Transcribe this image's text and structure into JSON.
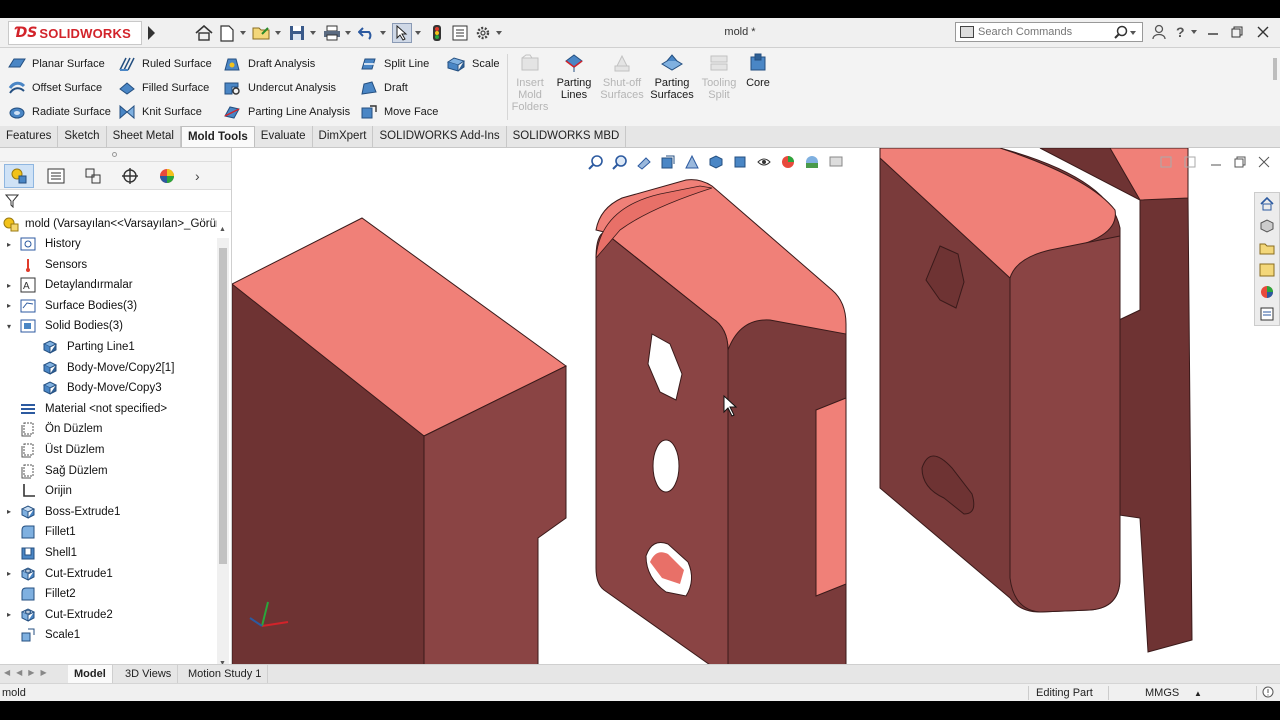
{
  "title_bar": {
    "app_name": "SOLIDWORKS",
    "document_title": "mold *",
    "search_placeholder": "Search Commands"
  },
  "ribbon": {
    "col1": [
      "Planar Surface",
      "Offset Surface",
      "Radiate Surface"
    ],
    "col2": [
      "Ruled Surface",
      "Filled Surface",
      "Knit Surface"
    ],
    "col3": [
      "Draft Analysis",
      "Undercut Analysis",
      "Parting Line Analysis"
    ],
    "col4": [
      "Split Line",
      "Draft",
      "Move Face"
    ],
    "scale": "Scale",
    "big_buttons": [
      {
        "label": "Insert Mold Folders",
        "enabled": false
      },
      {
        "label": "Parting Lines",
        "enabled": true
      },
      {
        "label": "Shut-off Surfaces",
        "enabled": false
      },
      {
        "label": "Parting Surfaces",
        "enabled": true
      },
      {
        "label": "Tooling Split",
        "enabled": false
      },
      {
        "label": "Core",
        "enabled": true
      }
    ]
  },
  "tabs": [
    "Features",
    "Sketch",
    "Sheet Metal",
    "Mold Tools",
    "Evaluate",
    "DimXpert",
    "SOLIDWORKS Add-Ins",
    "SOLIDWORKS MBD"
  ],
  "active_tab": "Mold Tools",
  "feature_tree": {
    "root": "mold  (Varsayılan<<Varsayılan>_Görün",
    "nodes": [
      {
        "label": "History",
        "icon": "history-icon",
        "expandable": true,
        "indent": 0
      },
      {
        "label": "Sensors",
        "icon": "sensors-icon",
        "expandable": false,
        "indent": 0
      },
      {
        "label": "Detaylandırmalar",
        "icon": "annotations-icon",
        "expandable": true,
        "indent": 0
      },
      {
        "label": "Surface Bodies(3)",
        "icon": "surface-bodies-icon",
        "expandable": true,
        "indent": 0
      },
      {
        "label": "Solid Bodies(3)",
        "icon": "solid-bodies-icon",
        "expandable": true,
        "expanded": true,
        "indent": 0
      },
      {
        "label": "Parting Line1",
        "icon": "body-icon",
        "expandable": false,
        "indent": 1
      },
      {
        "label": "Body-Move/Copy2[1]",
        "icon": "body-icon",
        "expandable": false,
        "indent": 1
      },
      {
        "label": "Body-Move/Copy3",
        "icon": "body-icon",
        "expandable": false,
        "indent": 1
      },
      {
        "label": "Material <not specified>",
        "icon": "material-icon",
        "expandable": false,
        "indent": 0
      },
      {
        "label": "Ön Düzlem",
        "icon": "plane-icon",
        "expandable": false,
        "indent": 0
      },
      {
        "label": "Üst Düzlem",
        "icon": "plane-icon",
        "expandable": false,
        "indent": 0
      },
      {
        "label": "Sağ Düzlem",
        "icon": "plane-icon",
        "expandable": false,
        "indent": 0
      },
      {
        "label": "Orijin",
        "icon": "origin-icon",
        "expandable": false,
        "indent": 0
      },
      {
        "label": "Boss-Extrude1",
        "icon": "extrude-icon",
        "expandable": true,
        "indent": 0
      },
      {
        "label": "Fillet1",
        "icon": "fillet-icon",
        "expandable": false,
        "indent": 0
      },
      {
        "label": "Shell1",
        "icon": "shell-icon",
        "expandable": false,
        "indent": 0
      },
      {
        "label": "Cut-Extrude1",
        "icon": "cut-extrude-icon",
        "expandable": true,
        "indent": 0
      },
      {
        "label": "Fillet2",
        "icon": "fillet-icon",
        "expandable": false,
        "indent": 0
      },
      {
        "label": "Cut-Extrude2",
        "icon": "cut-extrude-icon",
        "expandable": true,
        "indent": 0
      },
      {
        "label": "Scale1",
        "icon": "scale-icon",
        "expandable": false,
        "indent": 0
      }
    ]
  },
  "bottom_tabs": [
    "Model",
    "3D Views",
    "Motion Study 1"
  ],
  "active_bottom_tab": "Model",
  "status_bar": {
    "left": "mold",
    "mode": "Editing Part",
    "units": "MMGS"
  },
  "colors": {
    "model_face_light": "#f08078",
    "model_face_mid": "#8a4444",
    "model_face_dark": "#6e3333",
    "accent_red": "#d2232a"
  }
}
